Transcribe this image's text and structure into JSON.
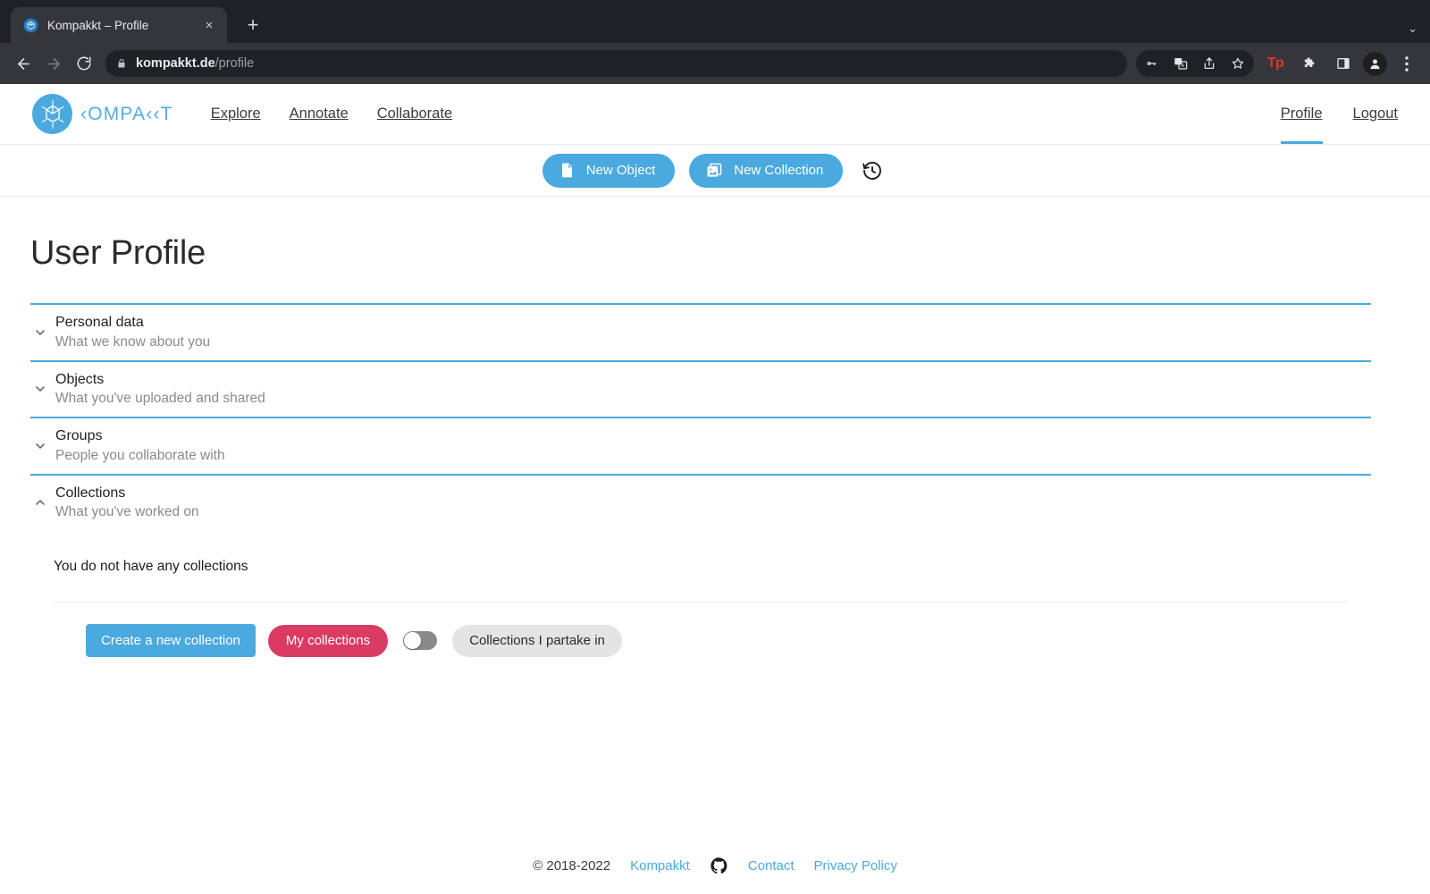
{
  "browser": {
    "tab": {
      "title": "Kompakkt – Profile",
      "favicon": "kompakkt-cube-icon",
      "close": "×"
    },
    "new_tab_label": "+",
    "tabstrip_chevron": "⌄",
    "nav": {
      "back": "←",
      "forward": "→",
      "reload": "⟳"
    },
    "omnibox": {
      "domain": "kompakkt.de",
      "path": "/profile",
      "lock": "lock-icon"
    },
    "toolbar_icons": [
      "password-key-icon",
      "translate-icon",
      "share-icon",
      "bookmark-star-icon",
      "tp-extension-icon",
      "extensions-puzzle-icon",
      "side-panel-icon",
      "profile-avatar-icon",
      "chrome-menu-icon"
    ]
  },
  "site": {
    "brand": {
      "wordmark": "‹OMPA‹‹T",
      "logo": "kompakkt-logo-icon"
    },
    "nav_links": [
      {
        "label": "Explore"
      },
      {
        "label": "Annotate"
      },
      {
        "label": "Collaborate"
      }
    ],
    "nav_right": [
      {
        "label": "Profile",
        "active": true
      },
      {
        "label": "Logout",
        "active": false
      }
    ]
  },
  "actionbar": {
    "new_object": {
      "label": "New Object",
      "icon": "file-document-icon"
    },
    "new_collection": {
      "label": "New Collection",
      "icon": "photo-library-icon"
    },
    "history": {
      "icon": "history-restore-icon"
    }
  },
  "main": {
    "title": "User Profile",
    "accordion": [
      {
        "title": "Personal data",
        "subtitle": "What we know about you",
        "expanded": false,
        "chevron": "chevron-down-icon"
      },
      {
        "title": "Objects",
        "subtitle": "What you've uploaded and shared",
        "expanded": false,
        "chevron": "chevron-down-icon"
      },
      {
        "title": "Groups",
        "subtitle": "People you collaborate with",
        "expanded": false,
        "chevron": "chevron-down-icon"
      },
      {
        "title": "Collections",
        "subtitle": "What you've worked on",
        "expanded": true,
        "chevron": "chevron-up-icon"
      }
    ],
    "collections_panel": {
      "empty_message": "You do not have any collections",
      "create_button": "Create a new collection",
      "filter_my": "My collections",
      "filter_partake": "Collections I partake in",
      "toggle_state": "off"
    }
  },
  "footer": {
    "copyright": "© 2018-2022",
    "brand_link": "Kompakkt",
    "github": "github-icon",
    "links": [
      {
        "label": "Contact"
      },
      {
        "label": "Privacy Policy"
      }
    ]
  },
  "colors": {
    "accent_blue": "#4aa9de",
    "accent_pink": "#d93b63",
    "chrome_dark": "#202124",
    "chrome_toolbar": "#35363a"
  }
}
